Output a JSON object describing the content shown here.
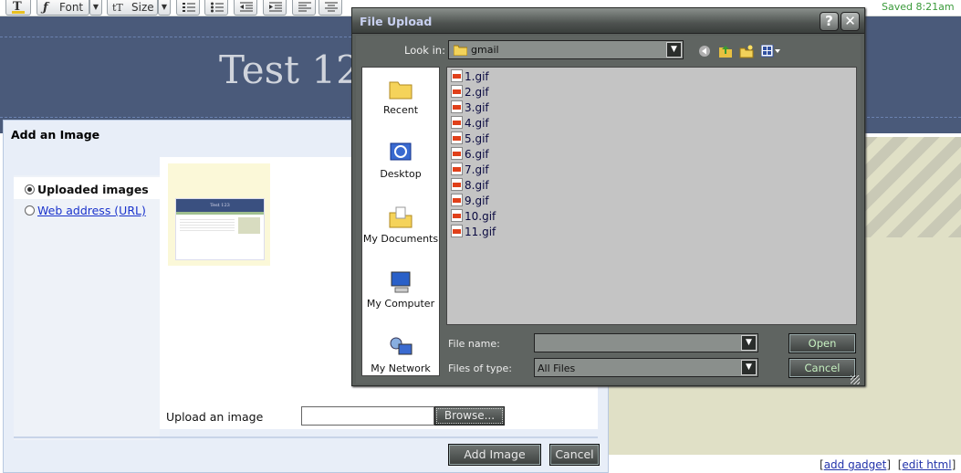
{
  "toolbar": {
    "font_label": "Font",
    "size_label": "Size",
    "status": "Saved 8:21am"
  },
  "blog": {
    "title_partial": "Test 12",
    "links": {
      "add_gadget": "add gadget",
      "edit_html": "edit html"
    }
  },
  "add_image": {
    "title": "Add an Image",
    "options": {
      "uploaded": "Uploaded images",
      "web": "Web address (URL)"
    },
    "thumbnail_title": "Test 123",
    "upload_label": "Upload an image",
    "browse_label": "Browse...",
    "add_label": "Add Image",
    "cancel_label": "Cancel"
  },
  "file_upload": {
    "title": "File Upload",
    "help_glyph": "?",
    "close_glyph": "✕",
    "look_in_label": "Look in:",
    "look_in_value": "gmail",
    "places": {
      "recent": "Recent",
      "desktop": "Desktop",
      "my_documents": "My Documents",
      "my_computer": "My Computer",
      "my_network": "My Network"
    },
    "files": [
      "1.gif",
      "2.gif",
      "3.gif",
      "4.gif",
      "5.gif",
      "6.gif",
      "7.gif",
      "8.gif",
      "9.gif",
      "10.gif",
      "11.gif"
    ],
    "file_name_label": "File name:",
    "file_name_value": "",
    "files_of_type_label": "Files of type:",
    "files_of_type_value": "All Files",
    "open_label": "Open",
    "cancel_label": "Cancel"
  },
  "colors": {
    "header_bg": "#4a5a7a",
    "dialog_bg": "#5a5f5c",
    "link": "#1a33cc",
    "saved": "#3a9a3a"
  }
}
